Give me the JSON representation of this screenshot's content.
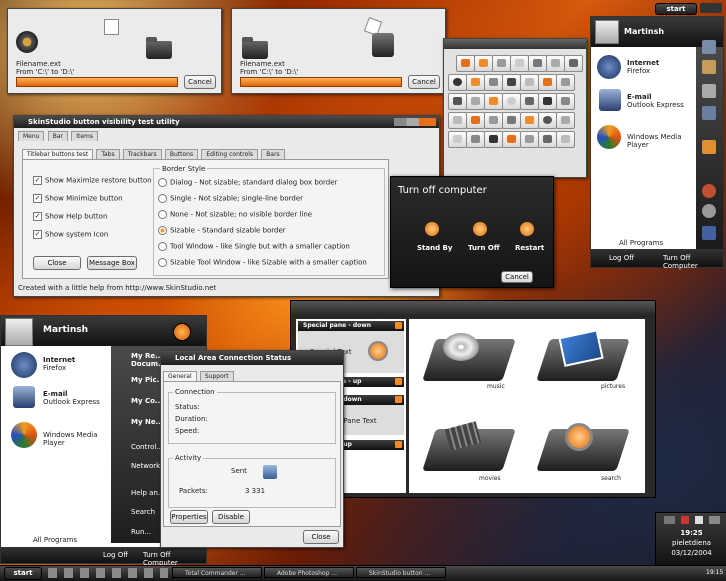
{
  "copy_dialog_1": {
    "filename": "Filename.ext",
    "from": "From 'C:\\' to 'D:\\'",
    "cancel": "Cancel"
  },
  "copy_dialog_2": {
    "filename": "Filename.ext",
    "from": "From 'C:\\' to 'D:\\'",
    "cancel": "Cancel"
  },
  "start_menu_right": {
    "user": "Martinsh",
    "items": [
      {
        "title": "Internet",
        "sub": "Firefox"
      },
      {
        "title": "E-mail",
        "sub": "Outlook Express"
      },
      {
        "title": "Windows Media Player",
        "sub": ""
      }
    ],
    "all_programs": "All Programs",
    "log_off": "Log Off",
    "turn_off": "Turn Off Computer"
  },
  "start_button": "start",
  "skinstudio": {
    "title": "SkinStudio button visibility test utility",
    "menus": [
      "Menu",
      "Bar",
      "Items"
    ],
    "tabs": [
      "Titlebar buttons test",
      "Tabs",
      "Trackbars",
      "Buttons",
      "Editing controls",
      "Bars"
    ],
    "checks": [
      "Show Maximize restore button",
      "Show Minimize button",
      "Show Help button",
      "Show system Icon"
    ],
    "border_style_label": "Border Style",
    "radios": [
      "Dialog - Not sizable; standard dialog box border",
      "Single - Not sizable; single-line border",
      "None - Not sizable; no visible border line",
      "Sizable - Standard sizable border",
      "Tool Window - like Single but with a smaller caption",
      "Sizable Tool Window - like Sizable with a smaller caption"
    ],
    "close": "Close",
    "message_box": "Message Box",
    "status": "Created with a little help from http://www.SkinStudio.net"
  },
  "turn_off": {
    "title": "Turn off computer",
    "stand_by": "Stand By",
    "turn_off": "Turn Off",
    "restart": "Restart",
    "cancel": "Cancel"
  },
  "start_menu_left": {
    "user": "Martinsh",
    "items": [
      {
        "title": "Internet",
        "sub": "Firefox"
      },
      {
        "title": "E-mail",
        "sub": "Outlook Express"
      },
      {
        "title": "Windows Media Player",
        "sub": ""
      }
    ],
    "right_items": [
      "My Re... Docum...",
      "My Pic...",
      "My Co...",
      "My Ne...",
      "Control...",
      "Network...",
      "Help an...",
      "Search",
      "Run..."
    ],
    "all_programs": "All Programs",
    "log_off": "Log Off",
    "turn_off": "Turn Off Computer"
  },
  "lan_status": {
    "title": "Local Area Connection Status",
    "tabs": [
      "General",
      "Support"
    ],
    "connection": "Connection",
    "status": "Status:",
    "duration": "Duration:",
    "speed": "Speed:",
    "activity": "Activity",
    "sent": "Sent",
    "packets": "Packets:",
    "packets_val": "3 331",
    "properties": "Properties",
    "disable": "Disable",
    "close": "Close"
  },
  "explorer": {
    "panes": [
      {
        "title": "Special pane - down",
        "text": "Special Text"
      },
      {
        "title": "Special pane - up",
        "text": ""
      },
      {
        "title": "Task pane - down",
        "text": "Task Pane Text"
      },
      {
        "title": "Task pane - up",
        "text": ""
      }
    ],
    "folders": [
      "music",
      "pictures",
      "movies",
      "search"
    ]
  },
  "clock": {
    "time1": "19:25",
    "user": "pieletdiena",
    "date": "03/12/2004",
    "time2": "19:15"
  },
  "taskbar": [
    "Total Commander ...",
    "Adobe Photoshop ...",
    "SkinStudio button ..."
  ],
  "colors": {
    "accent": "#f08a2a",
    "dark": "#1f1f1f"
  }
}
